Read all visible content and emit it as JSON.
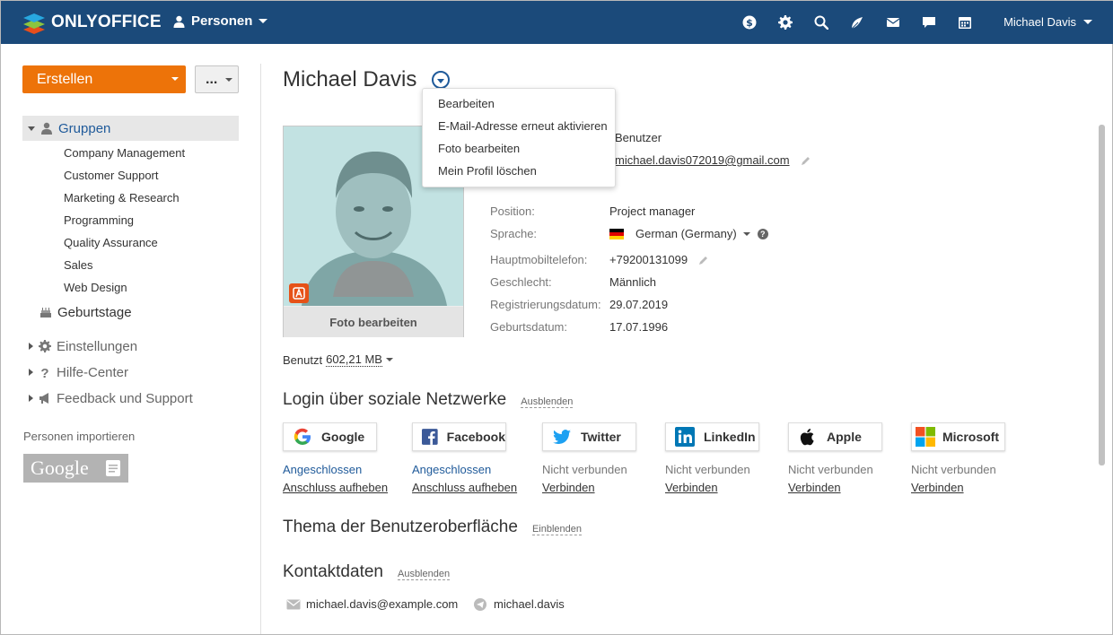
{
  "app": {
    "logo_text": "ONLYOFFICE",
    "module": "Personen",
    "user_name": "Michael Davis"
  },
  "header_icons": [
    "money-icon",
    "gear-icon",
    "search-icon",
    "feed-icon",
    "mail-icon",
    "chat-icon",
    "calendar-icon"
  ],
  "sidebar": {
    "create_label": "Erstellen",
    "more_label": "...",
    "groups_label": "Gruppen",
    "groups": [
      "Company Management",
      "Customer Support",
      "Marketing & Research",
      "Programming",
      "Quality Assurance",
      "Sales",
      "Web Design"
    ],
    "birthdays_label": "Geburtstage",
    "settings_label": "Einstellungen",
    "help_label": "Hilfe-Center",
    "feedback_label": "Feedback und Support",
    "import_label": "Personen importieren",
    "google_label": "Google"
  },
  "profile": {
    "name": "Michael Davis",
    "photo_caption": "Foto bearbeiten",
    "role": "Benutzer",
    "email": "michael.davis072019@gmail.com",
    "fields": [
      {
        "label": "Position:",
        "value": "Project manager"
      },
      {
        "label": "Sprache:",
        "value": "German (Germany)"
      },
      {
        "label": "Hauptmobiltelefon:",
        "value": "+79200131099"
      },
      {
        "label": "Geschlecht:",
        "value": "Männlich"
      },
      {
        "label": "Registrierungsdatum:",
        "value": "29.07.2019"
      },
      {
        "label": "Geburtsdatum:",
        "value": "17.07.1996"
      }
    ],
    "used_label": "Benutzt",
    "used_value": "602,21 MB"
  },
  "menu": {
    "items": [
      "Bearbeiten",
      "E-Mail-Adresse erneut aktivieren",
      "Foto bearbeiten",
      "Mein Profil löschen"
    ]
  },
  "social_section": {
    "title": "Login über soziale Netzwerke",
    "toggle": "Ausblenden",
    "networks": [
      {
        "name": "Google",
        "status": "Angeschlossen",
        "action": "Anschluss aufheben"
      },
      {
        "name": "Facebook",
        "status": "Angeschlossen",
        "action": "Anschluss aufheben"
      },
      {
        "name": "Twitter",
        "status": "Nicht verbunden",
        "action": "Verbinden"
      },
      {
        "name": "LinkedIn",
        "status": "Nicht verbunden",
        "action": "Verbinden"
      },
      {
        "name": "Apple",
        "status": "Nicht verbunden",
        "action": "Verbinden"
      },
      {
        "name": "Microsoft",
        "status": "Nicht verbunden",
        "action": "Verbinden"
      }
    ]
  },
  "theme_section": {
    "title": "Thema der Benutzeroberfläche",
    "toggle": "Einblenden"
  },
  "contact_section": {
    "title": "Kontaktdaten",
    "toggle": "Ausblenden",
    "email": "michael.davis@example.com",
    "telegram": "michael.davis"
  },
  "colors": {
    "topbar": "#1b4a7a",
    "accent": "#ed7309",
    "link": "#1f5a9a",
    "admin_badge": "#e65218"
  }
}
